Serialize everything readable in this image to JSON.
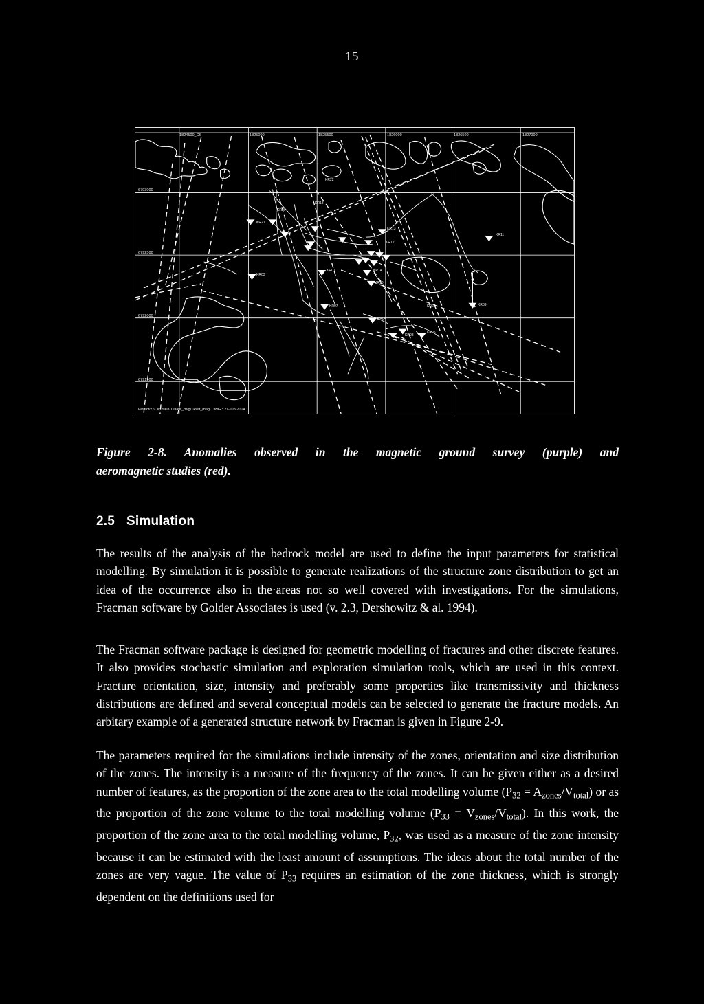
{
  "page": {
    "number": "15"
  },
  "figure": {
    "caption_line1": "Figure 2-8.  Anomalies  observed  in  the  magnetic  ground  survey  (purple)  and",
    "caption_line2": "aeromagnetic studies (red).",
    "plot_stamp": "Fintact/Z:\\Olk\\2003.1\\Data_dwg\\Tksat_mag\\.DWG  * 21-Jun-2004",
    "x_grid_labels": [
      "1824500_CS",
      "1825000",
      "1825500",
      "1826000",
      "1826500",
      "1827000"
    ],
    "y_grid_labels": [
      "6793000",
      "6792500",
      "6792000",
      "6791500"
    ],
    "borehole_labels": [
      "KR18",
      "KR22",
      "KR21",
      "KR20",
      "KR13",
      "KR12",
      "KR11",
      "KR03",
      "KR01",
      "KR14",
      "KR10",
      "KR09",
      "KR07",
      "KR22",
      "KR04",
      "KR05",
      "KR08"
    ],
    "legend_colors": {
      "ground_survey": "#800080",
      "aeromagnetic": "#ff0000",
      "background": "#000000",
      "line": "#ffffff"
    }
  },
  "section": {
    "number": "2.5",
    "title": "Simulation"
  },
  "body": {
    "paragraph1": "The results of the analysis of the bedrock model are used to define the input parameters for statistical modelling. By simulation it is possible to generate realizations of the structure zone distribution to get an idea of the occurrence also in the·areas not so well covered with investigations. For the simulations, Fracman software by Golder Associates is used (v. 2.3, Dershowitz & al. 1994).",
    "paragraph2": "The Fracman software package is designed for geometric modelling of fractures and other discrete features. It also provides stochastic simulation and exploration simulation tools, which are used in this context. Fracture orientation, size, intensity and preferably some properties like transmissivity and thickness distributions are defined and several conceptual models can be selected to generate the fracture models. An arbitary example of a generated structure network by Fracman is given in Figure 2-9.",
    "paragraph3_part1": "The parameters required for the simulations include intensity of the zones, orientation and size distribution of the zones. The intensity is a measure of the frequency of the zones. It can be given either as a desired number of features, as the proportion of the zone area to the total modelling volume (P",
    "p3_sub_a": "32",
    "paragraph3_part2": " = A",
    "p3_sub_b": "zones",
    "paragraph3_part3": "/V",
    "p3_sub_c": "total",
    "paragraph3_part4": ") or as the proportion of the zone volume to the total modelling volume (P",
    "p3_sub_d": "33",
    "paragraph3_part5": " = V",
    "p3_sub_e": "zones",
    "paragraph3_part6": "/V",
    "p3_sub_f": "total",
    "paragraph3_part7": "). In this work, the proportion of the zone area to the total modelling volume, P",
    "p3_sub_g": "32",
    "paragraph3_part8": ", was used as a measure of the zone intensity because it can be estimated with the least amount of assumptions. The ideas about the total number of the zones are very vague. The value of P",
    "p3_sub_h": "33",
    "paragraph3_part9": " requires an estimation of the zone thickness, which is strongly dependent on the definitions used for"
  }
}
